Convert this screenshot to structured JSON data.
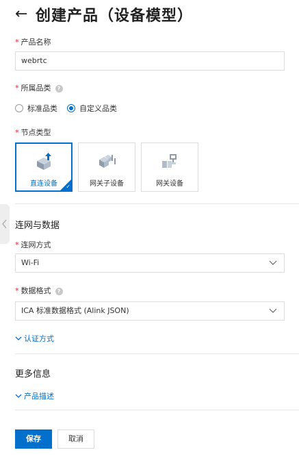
{
  "header": {
    "back_icon": "arrow-left-icon",
    "title": "创建产品（设备模型）"
  },
  "product_name": {
    "label": "产品名称",
    "required_mark": "*",
    "value": "webrtc"
  },
  "category": {
    "label": "所属品类",
    "required_mark": "*",
    "help": "?",
    "options": [
      {
        "label": "标准品类",
        "checked": false
      },
      {
        "label": "自定义品类",
        "checked": true
      }
    ]
  },
  "node_type": {
    "label": "节点类型",
    "required_mark": "*",
    "cards": [
      {
        "label": "直连设备",
        "icon": "direct-device-icon",
        "selected": true,
        "check": "✓"
      },
      {
        "label": "网关子设备",
        "icon": "gateway-subdevice-icon",
        "selected": false
      },
      {
        "label": "网关设备",
        "icon": "gateway-device-icon",
        "selected": false
      }
    ]
  },
  "network_section": {
    "title": "连网与数据",
    "connect_mode": {
      "label": "连网方式",
      "required_mark": "*",
      "value": "Wi-Fi"
    },
    "data_format": {
      "label": "数据格式",
      "required_mark": "*",
      "help": "?",
      "value": "ICA 标准数据格式 (Alink JSON)"
    },
    "auth_link": "认证方式"
  },
  "more_section": {
    "title": "更多信息",
    "desc_link": "产品描述"
  },
  "actions": {
    "save_label": "保存",
    "cancel_label": "取消"
  },
  "colors": {
    "accent": "#0070cc",
    "required": "#f5222d",
    "border": "#dcdcdc"
  }
}
